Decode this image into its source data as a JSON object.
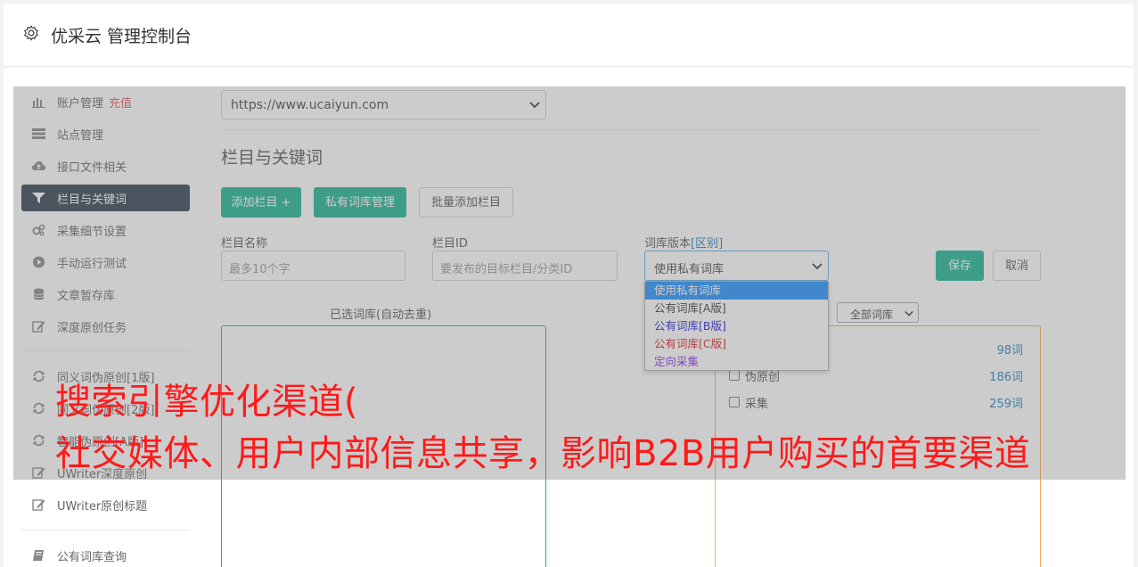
{
  "header": {
    "title": "优采云 管理控制台"
  },
  "sidebar": {
    "items": [
      {
        "label": "账户管理",
        "extra": "充值",
        "icon": "bar-chart-icon"
      },
      {
        "label": "站点管理",
        "icon": "server-icon"
      },
      {
        "label": "接口文件相关",
        "icon": "cloud-upload-icon"
      },
      {
        "label": "栏目与关键词",
        "icon": "filter-icon",
        "active": true
      },
      {
        "label": "采集细节设置",
        "icon": "gears-icon"
      },
      {
        "label": "手动运行测试",
        "icon": "play-circle-icon"
      },
      {
        "label": "文章暂存库",
        "icon": "database-icon"
      },
      {
        "label": "深度原创任务",
        "icon": "edit-icon"
      },
      {
        "label": "同义词伪原创[1版]",
        "icon": "refresh-icon"
      },
      {
        "label": "同义词伪原创[2版]",
        "icon": "refresh-icon"
      },
      {
        "label": "智能伪原创[A版]",
        "icon": "refresh-icon"
      },
      {
        "label": "UWriter深度原创",
        "icon": "edit-icon"
      },
      {
        "label": "UWriter原创标题",
        "icon": "edit-icon"
      },
      {
        "label": "公有词库查询",
        "icon": "book-icon"
      }
    ]
  },
  "site_select": {
    "value": "https://www.ucaiyun.com"
  },
  "section_title": "栏目与关键词",
  "buttons": {
    "add_column": "添加栏目 +",
    "private_lib": "私有词库管理",
    "batch_add": "批量添加栏目",
    "save": "保存",
    "cancel": "取消"
  },
  "form": {
    "column_name_label": "栏目名称",
    "column_name_placeholder": "最多10个字",
    "column_id_label": "栏目ID",
    "column_id_placeholder": "要发布的目标栏目/分类ID",
    "lib_version_label": "词库版本",
    "lib_version_link": "[区别]",
    "lib_version_value": "使用私有词库",
    "lib_version_options": [
      {
        "label": "使用私有词库",
        "color": "#ffffff"
      },
      {
        "label": "公有词库[A版]",
        "color": "#333333"
      },
      {
        "label": "公有词库[B版]",
        "color": "#1c1cd6"
      },
      {
        "label": "公有词库[C版]",
        "color": "#d62020"
      },
      {
        "label": "定向采集",
        "color": "#8a2be2"
      }
    ]
  },
  "selected_libs": {
    "title": "已选词库(自动去重)"
  },
  "all_libs": {
    "filter": "全部词库",
    "rows": [
      {
        "name": "",
        "count": "98词"
      },
      {
        "name": "伪原创",
        "count": "186词"
      },
      {
        "name": "采集",
        "count": "259词"
      }
    ]
  },
  "caption": {
    "line1": "搜索引擎优化渠道(",
    "line2": "社交媒体、用户内部信息共享，影响B2B用户购买的首要渠道"
  }
}
